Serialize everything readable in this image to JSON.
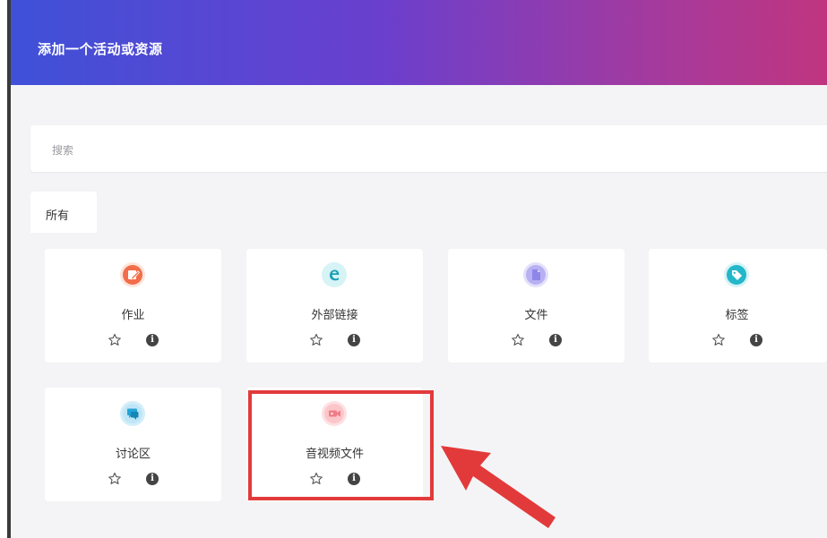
{
  "dialog": {
    "title": "添加一个活动或资源"
  },
  "search": {
    "placeholder": "搜索"
  },
  "tabs": [
    {
      "label": "所有"
    }
  ],
  "items": [
    {
      "label": "作业",
      "icon": "assignment-icon",
      "color": "#f26d4a"
    },
    {
      "label": "外部链接",
      "icon": "external-link-icon",
      "color": "#23b7c9"
    },
    {
      "label": "文件",
      "icon": "file-icon",
      "color": "#8f86e8"
    },
    {
      "label": "标签",
      "icon": "label-tag-icon",
      "color": "#23b7c9"
    },
    {
      "label": "讨论区",
      "icon": "forum-icon",
      "color": "#23a3d6"
    },
    {
      "label": "音视频文件",
      "icon": "video-file-icon",
      "color": "#f07c85"
    }
  ],
  "card_actions": {
    "star_icon": "star-icon",
    "info_icon": "info-icon",
    "info_glyph": "i"
  },
  "annotation": {
    "highlight_color": "#e23a3a"
  }
}
